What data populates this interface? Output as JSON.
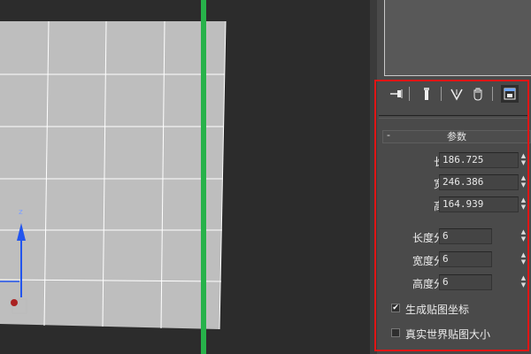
{
  "colors": {
    "accent_highlight": "#e01515",
    "grid_line": "#ffffff",
    "plane_fill": "#bebebe",
    "green_line": "#27b24a"
  },
  "toolbar": {
    "icons": [
      "pin-icon",
      "pipe-icon",
      "v-split-icon",
      "hand-icon",
      "configure-icon"
    ]
  },
  "rollout": {
    "collapse_symbol": "-",
    "title": "参数"
  },
  "params": [
    {
      "label": "长度:",
      "value": "186.725"
    },
    {
      "label": "宽度:",
      "value": "246.386"
    },
    {
      "label": "高度:",
      "value": "164.939"
    }
  ],
  "segments": [
    {
      "label": "长度分段:",
      "value": "6"
    },
    {
      "label": "宽度分段:",
      "value": "6"
    },
    {
      "label": "高度分段:",
      "value": "6"
    }
  ],
  "checkboxes": [
    {
      "label": "生成贴图坐标",
      "checked": true,
      "mark": "✔"
    },
    {
      "label": "真实世界贴图大小",
      "checked": false,
      "mark": ""
    }
  ],
  "viewport": {
    "axis_label": "z"
  }
}
